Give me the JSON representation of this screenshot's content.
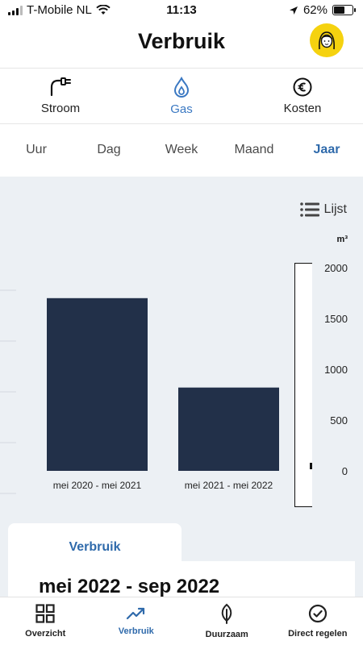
{
  "status_bar": {
    "carrier": "T-Mobile NL",
    "time": "11:13",
    "battery": "62%",
    "battery_level": 0.62
  },
  "header": {
    "title": "Verbruik"
  },
  "energy_tabs": [
    {
      "label": "Stroom",
      "icon": "plug-icon",
      "active": false
    },
    {
      "label": "Gas",
      "icon": "flame-icon",
      "active": true
    },
    {
      "label": "Kosten",
      "icon": "euro-icon",
      "active": false
    }
  ],
  "period_tabs": [
    {
      "label": "Uur",
      "active": false
    },
    {
      "label": "Dag",
      "active": false
    },
    {
      "label": "Week",
      "active": false
    },
    {
      "label": "Maand",
      "active": false
    },
    {
      "label": "Jaar",
      "active": true
    }
  ],
  "list_toggle": {
    "label": "Lijst"
  },
  "chart_data": {
    "type": "bar",
    "unit": "m³",
    "categories": [
      "mei 2020 - mei 2021",
      "mei 2021 - mei 2022"
    ],
    "values": [
      1700,
      820
    ],
    "ylim": [
      0,
      2000
    ],
    "yticks": [
      "2000",
      "1500",
      "1000",
      "500",
      "0"
    ],
    "bar_color": "#223049"
  },
  "card": {
    "tab_label": "Verbruik",
    "title": "mei 2022 - sep 2022"
  },
  "bottom_nav": [
    {
      "label": "Overzicht",
      "icon": "grid-icon",
      "active": false
    },
    {
      "label": "Verbruik",
      "icon": "trend-icon",
      "active": true
    },
    {
      "label": "Duurzaam",
      "icon": "leaf-icon",
      "active": false
    },
    {
      "label": "Direct regelen",
      "icon": "check-circle-icon",
      "active": false
    }
  ],
  "colors": {
    "accent": "#2f6aab",
    "avatar": "#f5d20f",
    "chart_bg": "#ecf0f4"
  }
}
